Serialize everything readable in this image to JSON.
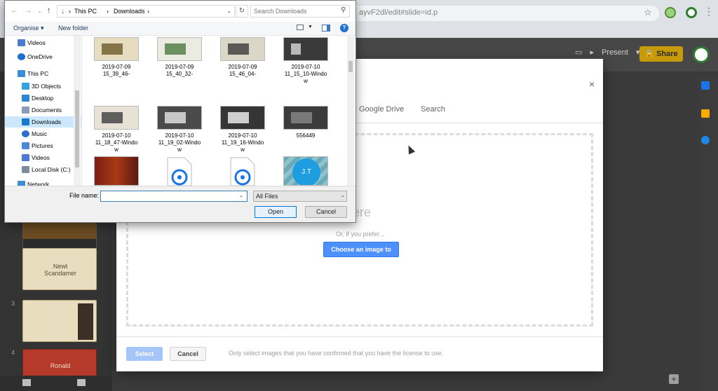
{
  "browser": {
    "address_text": "ayvF2dl/edit#slide=id.p",
    "present_label": "Present",
    "share_label": "Share"
  },
  "slides_panel": {
    "thumbs": [
      {
        "num": "",
        "text": ""
      },
      {
        "num": "",
        "text": "Newt\nScandamer"
      },
      {
        "num": "3",
        "text": ""
      },
      {
        "num": "4",
        "text": "Ronald"
      }
    ]
  },
  "insert_dialog": {
    "close_label": "×",
    "tabs": [
      "Google Drive",
      "Search"
    ],
    "drop_text": "mage here",
    "or_text": "Or, if you prefer...",
    "choose_label": "Choose an image to upload",
    "select_label": "Select",
    "cancel_label": "Cancel",
    "license_note": "Only select images that you have confirmed that you have the license to use."
  },
  "file_dialog": {
    "path": [
      "This PC",
      "Downloads"
    ],
    "search_placeholder": "Search Downloads",
    "organise_label": "Organise ▾",
    "new_folder_label": "New folder",
    "help_label": "?",
    "nav_items": [
      {
        "label": "Videos",
        "icon": "videos-icon",
        "color": "#4b7bd3"
      },
      {
        "label": "OneDrive",
        "icon": "onedrive-icon",
        "color": "#1c6fd1"
      },
      {
        "label": "This PC",
        "icon": "pc-icon",
        "color": "#3a8fd6"
      },
      {
        "label": "3D Objects",
        "icon": "cube-icon",
        "color": "#36a2e0"
      },
      {
        "label": "Desktop",
        "icon": "desktop-icon",
        "color": "#2f86d0"
      },
      {
        "label": "Documents",
        "icon": "documents-icon",
        "color": "#8a9bb3"
      },
      {
        "label": "Downloads",
        "icon": "downloads-icon",
        "color": "#1979ca"
      },
      {
        "label": "Music",
        "icon": "music-icon",
        "color": "#2d6ec9"
      },
      {
        "label": "Pictures",
        "icon": "pictures-icon",
        "color": "#4f8ad6"
      },
      {
        "label": "Videos",
        "icon": "videos-icon",
        "color": "#4b7bd3"
      },
      {
        "label": "Local Disk (C:)",
        "icon": "disk-icon",
        "color": "#7d8a99"
      },
      {
        "label": "Network",
        "icon": "network-icon",
        "color": "#3a8fd6"
      }
    ],
    "files": [
      {
        "label": "2019-07-09\n15_39_46-",
        "thumb_bg": "#e6dcc0",
        "accent": "#6d5a2b"
      },
      {
        "label": "2019-07-09\n15_40_32-",
        "thumb_bg": "#ecebe2",
        "accent": "#4c7a3f"
      },
      {
        "label": "2019-07-09\n15_46_04-",
        "thumb_bg": "#dad7c9",
        "accent": "#3a3a3a"
      },
      {
        "label": "2019-07-10\n11_15_10-Windo\nw",
        "thumb_bg": "#3a3a3a",
        "accent": "#d9d9d9"
      },
      {
        "label": "2019-07-10\n11_18_47-Windo\nw",
        "thumb_bg": "#e8e2d6",
        "accent": "#3d3d3d"
      },
      {
        "label": "2019-07-10\n11_19_02-Windo\nw",
        "thumb_bg": "#4a4a4a",
        "accent": "#e6e6e6"
      },
      {
        "label": "2019-07-10\n11_19_16-Windo\nw",
        "thumb_bg": "#353535",
        "accent": "#f5f5f5"
      },
      {
        "label": "556449",
        "thumb_bg": "#3b3b3b",
        "accent": "#8a8a8a"
      },
      {
        "label": "",
        "thumb_bg": "#7b1f12",
        "accent": "#c98a1e"
      },
      {
        "label": "",
        "thumb_bg": "#ffffff",
        "accent": "#1a73e8"
      },
      {
        "label": "",
        "thumb_bg": "#ffffff",
        "accent": "#1a73e8"
      },
      {
        "label": "",
        "thumb_bg": "#6aa9b7",
        "accent": "#1e9de0"
      }
    ],
    "filename_label": "File name:",
    "filename_value": "",
    "filetype_value": "All Files",
    "open_label": "Open",
    "cancel_label": "Cancel"
  },
  "file_badge": "J.T"
}
